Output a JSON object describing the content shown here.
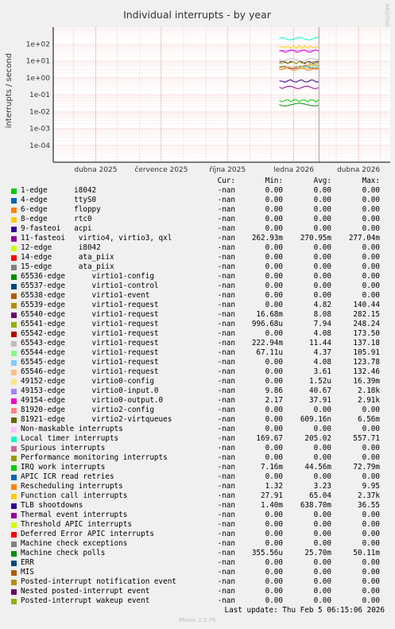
{
  "chart_data": {
    "type": "line",
    "title": "Individual interrupts - by year",
    "ylabel": "interrupts / second",
    "y_scale": "log",
    "ylim": [
      1e-05,
      1000
    ],
    "y_ticks": [
      {
        "v": 100,
        "label": "1e+02"
      },
      {
        "v": 10,
        "label": "1e+01"
      },
      {
        "v": 1,
        "label": "1e+00"
      },
      {
        "v": 0.1,
        "label": "1e-01"
      },
      {
        "v": 0.01,
        "label": "1e-02"
      },
      {
        "v": 0.001,
        "label": "1e-03"
      },
      {
        "v": 0.0001,
        "label": "1e-04"
      }
    ],
    "xlim": [
      "2025-02-01",
      "2026-05-15"
    ],
    "x_ticks": [
      {
        "date": "2025-04-01",
        "label": "dubna 2025"
      },
      {
        "date": "2025-07-01",
        "label": "července 2025"
      },
      {
        "date": "2025-10-01",
        "label": "října 2025"
      },
      {
        "date": "2026-01-01",
        "label": "ledna 2026"
      },
      {
        "date": "2026-04-01",
        "label": "dubna 2026"
      }
    ],
    "now_marker": "2026-02-05",
    "data_start": "2025-12-12",
    "grid": true,
    "watermark": "RRDTOOL / TOBI OETIKER",
    "columns": [
      "Cur:",
      "Min:",
      "Avg:",
      "Max:"
    ],
    "series": [
      {
        "name": "1-edge      i8042",
        "color": "#00cc00",
        "cur": "-nan",
        "min": "0.00",
        "avg": "0.00",
        "max": "0.00",
        "plot": []
      },
      {
        "name": "4-edge      ttyS0",
        "color": "#0066b3",
        "cur": "-nan",
        "min": "0.00",
        "avg": "0.00",
        "max": "0.00",
        "plot": []
      },
      {
        "name": "6-edge      floppy",
        "color": "#ff8000",
        "cur": "-nan",
        "min": "0.00",
        "avg": "0.00",
        "max": "0.00",
        "plot": []
      },
      {
        "name": "8-edge      rtc0",
        "color": "#ffcc00",
        "cur": "-nan",
        "min": "0.00",
        "avg": "0.00",
        "max": "0.00",
        "plot": []
      },
      {
        "name": "9-fasteoi   acpi",
        "color": "#330099",
        "cur": "-nan",
        "min": "0.00",
        "avg": "0.00",
        "max": "0.00",
        "plot": []
      },
      {
        "name": "11-fasteoi   virtio4, virtio3, qxl",
        "color": "#990099",
        "cur": "-nan",
        "min": "262.93m",
        "avg": "270.95m",
        "max": "277.04m",
        "plot": [
          0.27
        ]
      },
      {
        "name": "12-edge      i8042",
        "color": "#ccff00",
        "cur": "-nan",
        "min": "0.00",
        "avg": "0.00",
        "max": "0.00",
        "plot": []
      },
      {
        "name": "14-edge      ata_piix",
        "color": "#ff0000",
        "cur": "-nan",
        "min": "0.00",
        "avg": "0.00",
        "max": "0.00",
        "plot": []
      },
      {
        "name": "15-edge      ata_piix",
        "color": "#808080",
        "cur": "-nan",
        "min": "0.00",
        "avg": "0.00",
        "max": "0.00",
        "plot": []
      },
      {
        "name": "65536-edge      virtio1-config",
        "color": "#008f00",
        "cur": "-nan",
        "min": "0.00",
        "avg": "0.00",
        "max": "0.00",
        "plot": []
      },
      {
        "name": "65537-edge      virtio1-control",
        "color": "#00487d",
        "cur": "-nan",
        "min": "0.00",
        "avg": "0.00",
        "max": "0.00",
        "plot": []
      },
      {
        "name": "65538-edge      virtio1-event",
        "color": "#b35a00",
        "cur": "-nan",
        "min": "0.00",
        "avg": "0.00",
        "max": "0.00",
        "plot": []
      },
      {
        "name": "65539-edge      virtio1-request",
        "color": "#b38f00",
        "cur": "-nan",
        "min": "0.00",
        "avg": "4.82",
        "max": "140.44",
        "plot": [
          4.8
        ]
      },
      {
        "name": "65540-edge      virtio1-request",
        "color": "#6b006b",
        "cur": "-nan",
        "min": "16.68m",
        "avg": "8.08",
        "max": "282.15",
        "plot": [
          8.1
        ]
      },
      {
        "name": "65541-edge      virtio1-request",
        "color": "#8fb300",
        "cur": "-nan",
        "min": "996.68u",
        "avg": "7.94",
        "max": "248.24",
        "plot": [
          7.9
        ]
      },
      {
        "name": "65542-edge      virtio1-request",
        "color": "#b30000",
        "cur": "-nan",
        "min": "0.00",
        "avg": "4.08",
        "max": "173.50",
        "plot": [
          4.1
        ]
      },
      {
        "name": "65543-edge      virtio1-request",
        "color": "#bebebe",
        "cur": "-nan",
        "min": "222.94m",
        "avg": "11.44",
        "max": "137.18",
        "plot": [
          11.4
        ]
      },
      {
        "name": "65544-edge      virtio1-request",
        "color": "#80ff80",
        "cur": "-nan",
        "min": "67.11u",
        "avg": "4.37",
        "max": "105.91",
        "plot": [
          4.4
        ]
      },
      {
        "name": "65545-edge      virtio1-request",
        "color": "#80c9ff",
        "cur": "-nan",
        "min": "0.00",
        "avg": "4.08",
        "max": "123.78",
        "plot": [
          4.1
        ]
      },
      {
        "name": "65546-edge      virtio1-request",
        "color": "#ffc080",
        "cur": "-nan",
        "min": "0.00",
        "avg": "3.61",
        "max": "132.46",
        "plot": [
          3.6
        ]
      },
      {
        "name": "49152-edge      virtio0-config",
        "color": "#ffe680",
        "cur": "-nan",
        "min": "0.00",
        "avg": "1.52u",
        "max": "16.39m",
        "plot": []
      },
      {
        "name": "49153-edge      virtio0-input.0",
        "color": "#aa80ff",
        "cur": "-nan",
        "min": "9.86",
        "avg": "40.67",
        "max": "2.18k",
        "plot": [
          40.7
        ]
      },
      {
        "name": "49154-edge      virtio0-output.0",
        "color": "#ee00cc",
        "cur": "-nan",
        "min": "2.17",
        "avg": "37.91",
        "max": "2.91k",
        "plot": [
          37.9
        ]
      },
      {
        "name": "81920-edge      virtio2-config",
        "color": "#ff8080",
        "cur": "-nan",
        "min": "0.00",
        "avg": "0.00",
        "max": "0.00",
        "plot": []
      },
      {
        "name": "81921-edge      virtio2-virtqueues",
        "color": "#666600",
        "cur": "-nan",
        "min": "0.00",
        "avg": "609.16n",
        "max": "6.56m",
        "plot": []
      },
      {
        "name": "Non-maskable interrupts",
        "color": "#ffbfff",
        "cur": "-nan",
        "min": "0.00",
        "avg": "0.00",
        "max": "0.00",
        "plot": []
      },
      {
        "name": "Local timer interrupts",
        "color": "#00ffcc",
        "cur": "-nan",
        "min": "169.67",
        "avg": "205.02",
        "max": "557.71",
        "plot": [
          205
        ]
      },
      {
        "name": "Spurious interrupts",
        "color": "#cc6699",
        "cur": "-nan",
        "min": "0.00",
        "avg": "0.00",
        "max": "0.00",
        "plot": []
      },
      {
        "name": "Performance monitoring interrupts",
        "color": "#999900",
        "cur": "-nan",
        "min": "0.00",
        "avg": "0.00",
        "max": "0.00",
        "plot": []
      },
      {
        "name": "IRQ work interrupts",
        "color": "#00cc00",
        "cur": "-nan",
        "min": "7.16m",
        "avg": "44.56m",
        "max": "72.79m",
        "plot": [
          0.0446
        ]
      },
      {
        "name": "APIC ICR read retries",
        "color": "#0066b3",
        "cur": "-nan",
        "min": "0.00",
        "avg": "0.00",
        "max": "0.00",
        "plot": []
      },
      {
        "name": "Rescheduling interrupts",
        "color": "#ff8000",
        "cur": "-nan",
        "min": "1.32",
        "avg": "3.23",
        "max": "9.95",
        "plot": [
          3.2
        ]
      },
      {
        "name": "Function call interrupts",
        "color": "#ffcc00",
        "cur": "-nan",
        "min": "27.91",
        "avg": "65.04",
        "max": "2.37k",
        "plot": [
          65
        ]
      },
      {
        "name": "TLB shootdowns",
        "color": "#330099",
        "cur": "-nan",
        "min": "1.40m",
        "avg": "638.70m",
        "max": "36.55",
        "plot": [
          0.64
        ]
      },
      {
        "name": "Thermal event interrupts",
        "color": "#990099",
        "cur": "-nan",
        "min": "0.00",
        "avg": "0.00",
        "max": "0.00",
        "plot": []
      },
      {
        "name": "Threshold APIC interrupts",
        "color": "#ccff00",
        "cur": "-nan",
        "min": "0.00",
        "avg": "0.00",
        "max": "0.00",
        "plot": []
      },
      {
        "name": "Deferred Error APIC interrupts",
        "color": "#ff0000",
        "cur": "-nan",
        "min": "0.00",
        "avg": "0.00",
        "max": "0.00",
        "plot": []
      },
      {
        "name": "Machine check exceptions",
        "color": "#808080",
        "cur": "-nan",
        "min": "0.00",
        "avg": "0.00",
        "max": "0.00",
        "plot": []
      },
      {
        "name": "Machine check polls",
        "color": "#008f00",
        "cur": "-nan",
        "min": "355.56u",
        "avg": "25.70m",
        "max": "50.11m",
        "plot": [
          0.0257
        ]
      },
      {
        "name": "ERR",
        "color": "#00487d",
        "cur": "-nan",
        "min": "0.00",
        "avg": "0.00",
        "max": "0.00",
        "plot": []
      },
      {
        "name": "MIS",
        "color": "#b35a00",
        "cur": "-nan",
        "min": "0.00",
        "avg": "0.00",
        "max": "0.00",
        "plot": []
      },
      {
        "name": "Posted-interrupt notification event",
        "color": "#b38f00",
        "cur": "-nan",
        "min": "0.00",
        "avg": "0.00",
        "max": "0.00",
        "plot": []
      },
      {
        "name": "Nested posted-interrupt event",
        "color": "#6b006b",
        "cur": "-nan",
        "min": "0.00",
        "avg": "0.00",
        "max": "0.00",
        "plot": []
      },
      {
        "name": "Posted-interrupt wakeup event",
        "color": "#8fb300",
        "cur": "-nan",
        "min": "0.00",
        "avg": "0.00",
        "max": "0.00",
        "plot": []
      }
    ]
  },
  "last_update": "Last update: Thu Feb  5 06:15:06 2026",
  "footer": "Munin 2.0.76"
}
